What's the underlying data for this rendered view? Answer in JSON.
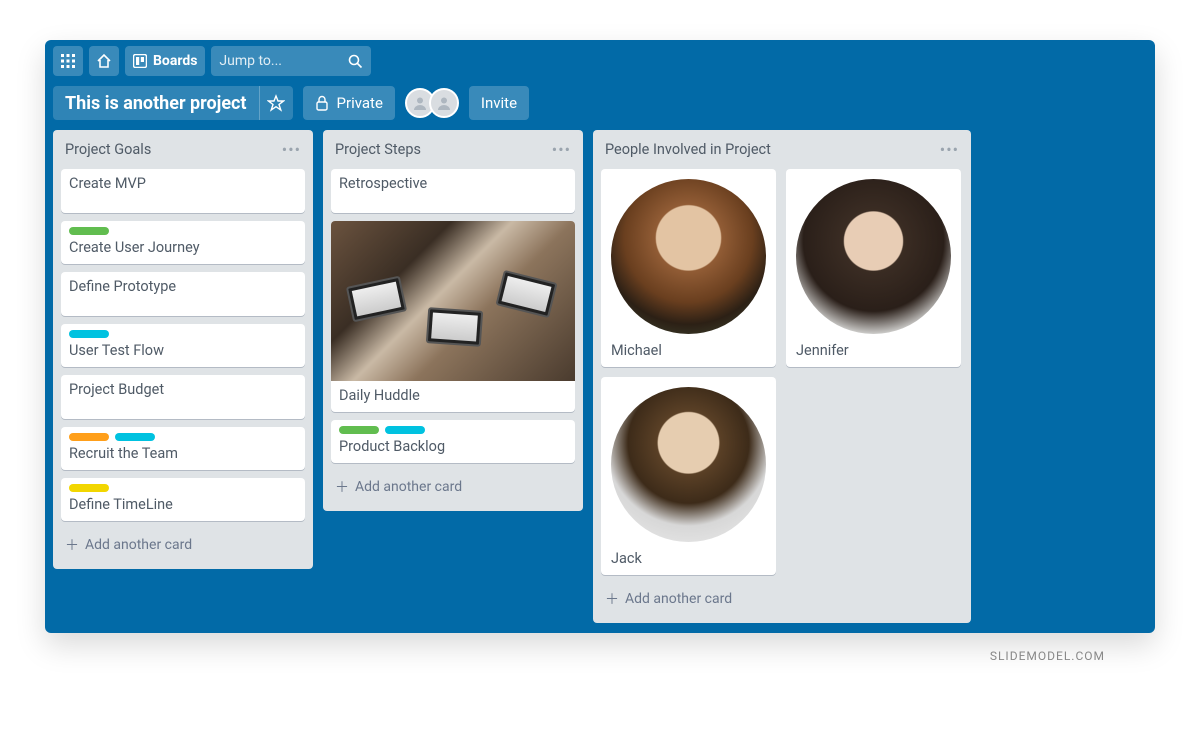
{
  "topbar": {
    "boards_label": "Boards",
    "search_placeholder": "Jump to..."
  },
  "board": {
    "title": "This is another project",
    "visibility": "Private",
    "invite_label": "Invite"
  },
  "lists": [
    {
      "title": "Project Goals",
      "add_label": "Add another card",
      "cards": [
        {
          "title": "Create MVP",
          "labels": [],
          "tall": true
        },
        {
          "title": "Create User Journey",
          "labels": [
            "green"
          ]
        },
        {
          "title": "Define Prototype",
          "labels": [],
          "tall": true
        },
        {
          "title": "User Test Flow",
          "labels": [
            "blue"
          ]
        },
        {
          "title": "Project Budget",
          "labels": [],
          "tall": true
        },
        {
          "title": "Recruit the Team",
          "labels": [
            "orange",
            "blue"
          ]
        },
        {
          "title": "Define TimeLine",
          "labels": [
            "yellow"
          ]
        }
      ]
    },
    {
      "title": "Project Steps",
      "add_label": "Add another card",
      "cards": [
        {
          "title": "Retrospective",
          "labels": [],
          "tall": true
        },
        {
          "title": "Daily Huddle",
          "labels": [],
          "image": true
        },
        {
          "title": "Product Backlog",
          "labels": [
            "green",
            "blue"
          ]
        }
      ]
    },
    {
      "title": "People Involved in Project",
      "add_label": "Add another card",
      "people": [
        {
          "name": "Michael",
          "photo_colors": [
            "#7a5a3d",
            "#c59a6b",
            "#2d2419"
          ]
        },
        {
          "name": "Jennifer",
          "photo_colors": [
            "#2a2321",
            "#caa88c",
            "#e8d9cc"
          ]
        },
        {
          "name": "Jack",
          "photo_colors": [
            "#4a3b2e",
            "#d9c2a8",
            "#e6e6e6"
          ]
        }
      ]
    }
  ],
  "footer": "SLIDEMODEL.COM"
}
